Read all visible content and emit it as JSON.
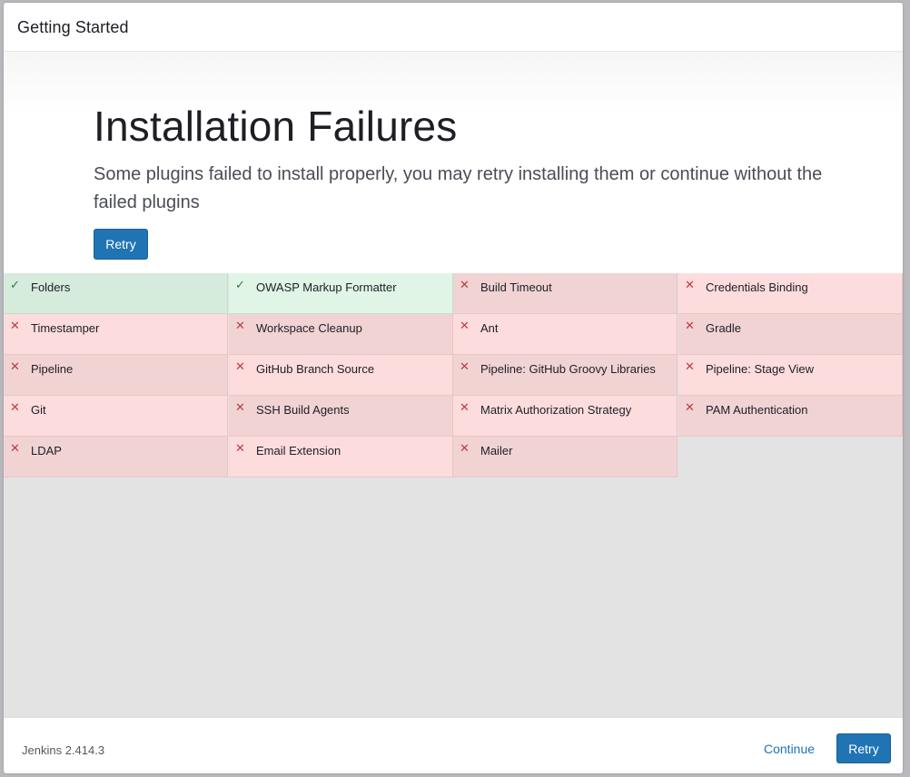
{
  "dialog": {
    "title": "Getting Started"
  },
  "hero": {
    "title": "Installation Failures",
    "description": "Some plugins failed to install properly, you may retry installing them or continue without the failed plugins",
    "retry_label": "Retry"
  },
  "plugins": [
    {
      "name": "Folders",
      "status": "success"
    },
    {
      "name": "OWASP Markup Formatter",
      "status": "success"
    },
    {
      "name": "Build Timeout",
      "status": "failed"
    },
    {
      "name": "Credentials Binding",
      "status": "failed"
    },
    {
      "name": "Timestamper",
      "status": "failed"
    },
    {
      "name": "Workspace Cleanup",
      "status": "failed"
    },
    {
      "name": "Ant",
      "status": "failed"
    },
    {
      "name": "Gradle",
      "status": "failed"
    },
    {
      "name": "Pipeline",
      "status": "failed"
    },
    {
      "name": "GitHub Branch Source",
      "status": "failed"
    },
    {
      "name": "Pipeline: GitHub Groovy Libraries",
      "status": "failed"
    },
    {
      "name": "Pipeline: Stage View",
      "status": "failed"
    },
    {
      "name": "Git",
      "status": "failed"
    },
    {
      "name": "SSH Build Agents",
      "status": "failed"
    },
    {
      "name": "Matrix Authorization Strategy",
      "status": "failed"
    },
    {
      "name": "PAM Authentication",
      "status": "failed"
    },
    {
      "name": "LDAP",
      "status": "failed"
    },
    {
      "name": "Email Extension",
      "status": "failed"
    },
    {
      "name": "Mailer",
      "status": "failed"
    }
  ],
  "status_icons": {
    "success": "checkmark-icon",
    "failed": "cross-icon"
  },
  "colors": {
    "accent": "#2074b4",
    "success": "#2c7a43",
    "failed": "#c23a3f"
  },
  "footer": {
    "version": "Jenkins 2.414.3",
    "continue_label": "Continue",
    "retry_label": "Retry"
  }
}
